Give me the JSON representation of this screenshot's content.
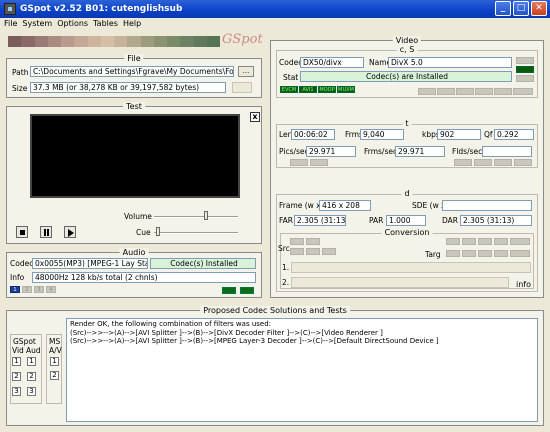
{
  "window": {
    "title": "GSpot v2.52 B01: cutenglishsub"
  },
  "menu": [
    "File",
    "System",
    "Options",
    "Tables",
    "Help"
  ],
  "logo": "GSpot",
  "gradient_colors": [
    "#7a5c5a",
    "#8a6a66",
    "#9a7a74",
    "#aa8a82",
    "#b89a8e",
    "#c4a896",
    "#ceb49e",
    "#d6bea6",
    "#c6b49a",
    "#b2a88c",
    "#9e9c7e",
    "#8a9272",
    "#7a8a68",
    "#6c8262",
    "#607a5c",
    "#567456"
  ],
  "file": {
    "title": "File",
    "path_label": "Path",
    "path_value": "C:\\Documents and Settings\\Fgrave\\My Documents\\For slag",
    "browse_label": "...",
    "size_label": "Size",
    "size_value": "37.3 MB (or 38,278 KB or 39,197,582 bytes)"
  },
  "test": {
    "title": "Test",
    "close_label": "x",
    "volume_label": "Volume",
    "cue_label": "Cue",
    "volume_level": 0.62,
    "cue_level": 0.05
  },
  "audio": {
    "title": "Audio",
    "codec_label": "Codec",
    "codec_value": "0x0055(MP3) [MPEG-1 Lay Stat",
    "codec_status": "Codec(s) Installed",
    "info_label": "Info",
    "info_value": "48000Hz 128 kb/s total (2 chnls)",
    "buttons": [
      "1",
      "2",
      "3",
      "4"
    ]
  },
  "video": {
    "title": "Video",
    "cs_title": "c, S",
    "codec_label": "Codec",
    "codec_value": "DX50/divx",
    "name_label": "Name",
    "name_value": "DivX 5.0",
    "stat_label": "Stat",
    "stat_value": "Codec(s) are Installed",
    "green_buttons": [
      "EVCM",
      "AVI1",
      "MOOP",
      "MUXM"
    ],
    "t_title": "t",
    "len_label": "Len",
    "len_value": "00:06:02",
    "frms_label": "Frms",
    "frms_value": "9,040",
    "kbps_label": "kbps",
    "kbps_value": "902",
    "qf_label": "Qf",
    "qf_value": "0.292",
    "pics_label": "Pics/sec",
    "pics_value": "29.971",
    "frms_sec_label": "Frms/sec",
    "frms_sec_value": "29.971",
    "flds_label": "Flds/sec",
    "flds_value": "",
    "d_title": "d",
    "frame_label": "Frame (w x",
    "frame_value": "416 x 208",
    "sde_label": "SDE (w x",
    "sde_value": "",
    "far_label": "FAR",
    "far_value": "2.305 (31:13)",
    "par_label": "PAR",
    "par_value": "1.000",
    "dar_label": "DAR",
    "dar_value": "2.305 (31:13)",
    "conversion_title": "Conversion",
    "src_label": "Src",
    "targ_label": "Targ",
    "row1_label": "1.",
    "row2_label": "2.",
    "info_button": "info"
  },
  "proposed": {
    "title": "Proposed Codec Solutions and Tests",
    "gspot_label": "GSpot",
    "vid_label": "Vid",
    "aud_label": "Aud",
    "ms_label": "MS",
    "ms_sub": "A/V",
    "vid_buttons": [
      "1",
      "2",
      "3"
    ],
    "aud_buttons": [
      "1",
      "2",
      "3"
    ],
    "ms_buttons": [
      "1",
      "2"
    ],
    "lines": [
      "Render OK, the following combination of filters was used:",
      "(Src)-->>-->(A)-->[AVI Splitter ]-->(B)-->[DivX Decoder Filter ]-->(C)-->[Video Renderer ]",
      "(Src)-->>-->(A)-->[AVI Splitter ]-->(B)-->[MPEG Layer-3 Decoder ]-->(C)-->[Default DirectSound Device ]"
    ]
  }
}
